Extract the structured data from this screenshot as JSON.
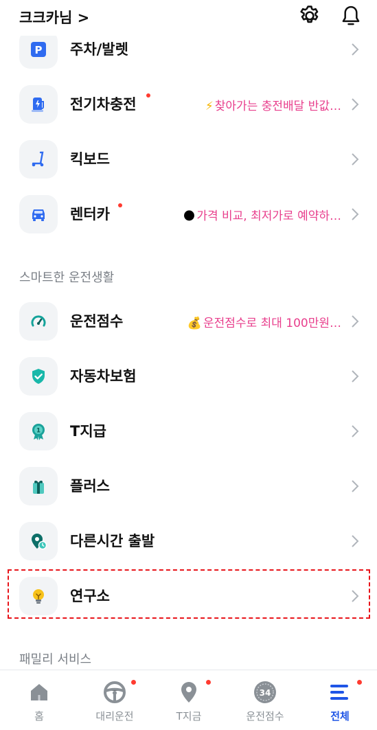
{
  "header": {
    "user_label": "크크카님 >"
  },
  "sections": {
    "smart_driving": "스마트한 운전생활",
    "family": "패밀리 서비스"
  },
  "rows": [
    {
      "label": "주차/발렛",
      "promo": "",
      "new_dot": false
    },
    {
      "label": "전기차충전",
      "promo": "찾아가는 충전배달 반값…",
      "promo_emoji": "⚡",
      "new_dot": true
    },
    {
      "label": "킥보드",
      "promo": "",
      "new_dot": false
    },
    {
      "label": "렌터카",
      "promo": "가격 비교, 최저가로 예약하…",
      "promo_emoji": "🌑",
      "new_dot": true
    },
    {
      "label": "운전점수",
      "promo": "운전점수로 최대 100만원…",
      "promo_emoji": "💰",
      "new_dot": false
    },
    {
      "label": "자동차보험",
      "promo": "",
      "new_dot": false
    },
    {
      "label": "T지급",
      "promo": "",
      "new_dot": false
    },
    {
      "label": "플러스",
      "promo": "",
      "new_dot": false
    },
    {
      "label": "다른시간 출발",
      "promo": "",
      "new_dot": false
    },
    {
      "label": "연구소",
      "promo": "",
      "new_dot": false
    }
  ],
  "tabbar": [
    {
      "label": "홈",
      "icon": "home-icon",
      "active": false,
      "dot": false
    },
    {
      "label": "대리운전",
      "icon": "steering-wheel-icon",
      "active": false,
      "dot": true
    },
    {
      "label": "T지금",
      "icon": "location-pin-icon",
      "active": false,
      "dot": true
    },
    {
      "label": "운전점수",
      "icon": "score-gauge-icon",
      "active": false,
      "dot": false,
      "badge": "34"
    },
    {
      "label": "전체",
      "icon": "menu-icon",
      "active": true,
      "dot": true
    }
  ],
  "colors": {
    "accent": "#1f55e6",
    "promo": "#e83e8c",
    "new_dot": "#ff3b30",
    "highlight_border": "#e8141a"
  }
}
